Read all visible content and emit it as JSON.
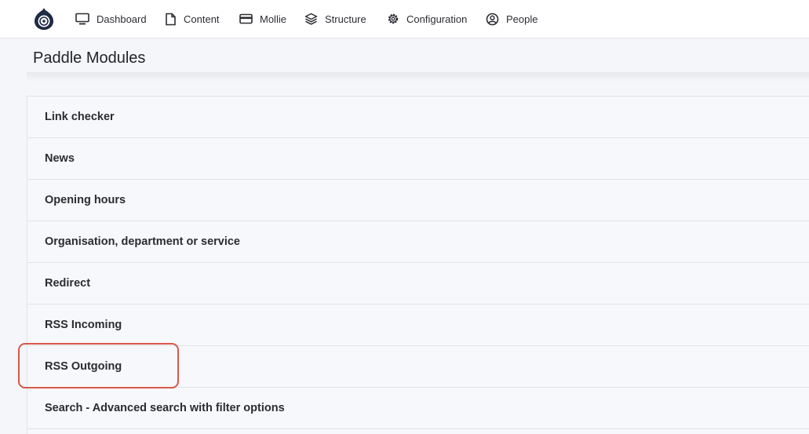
{
  "toolbar": {
    "items": [
      {
        "label": "Dashboard",
        "icon": "monitor-icon"
      },
      {
        "label": "Content",
        "icon": "file-icon"
      },
      {
        "label": "Mollie",
        "icon": "card-icon"
      },
      {
        "label": "Structure",
        "icon": "layers-icon"
      },
      {
        "label": "Configuration",
        "icon": "gear-icon"
      },
      {
        "label": "People",
        "icon": "user-circle-icon"
      }
    ]
  },
  "page": {
    "title": "Paddle Modules"
  },
  "modules": [
    {
      "label": "Link checker"
    },
    {
      "label": "News"
    },
    {
      "label": "Opening hours"
    },
    {
      "label": "Organisation, department or service"
    },
    {
      "label": "Redirect"
    },
    {
      "label": "RSS Incoming"
    },
    {
      "label": "RSS Outgoing"
    },
    {
      "label": "Search - Advanced search with filter options"
    }
  ],
  "colors": {
    "highlight": "#d9584a",
    "background": "#f4f6fa"
  }
}
